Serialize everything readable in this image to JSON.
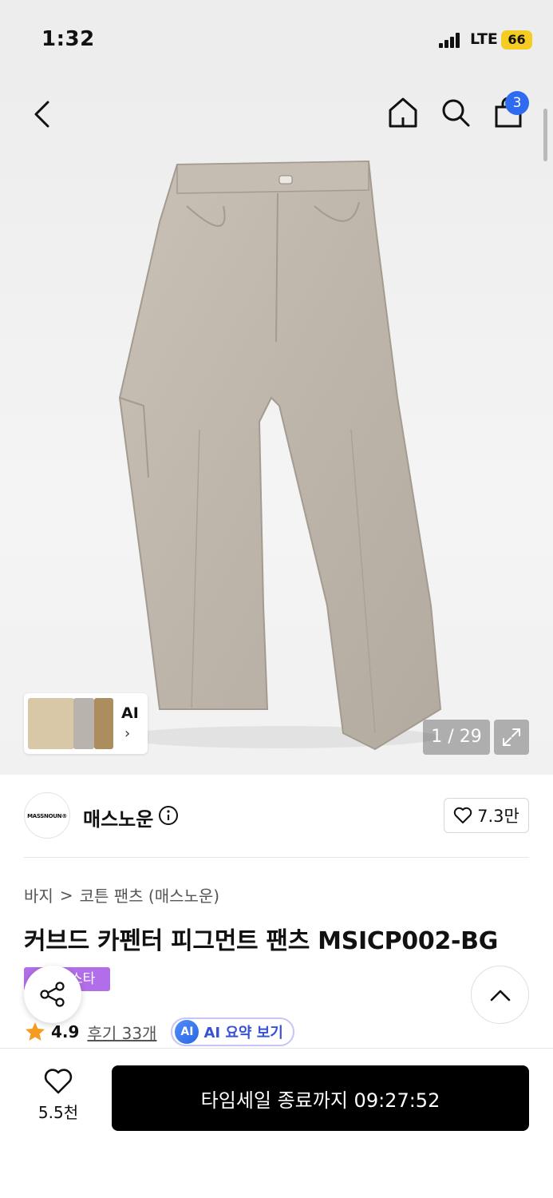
{
  "status": {
    "time": "1:32",
    "network": "LTE",
    "battery": "66"
  },
  "nav": {
    "cart_count": "3"
  },
  "gallery": {
    "counter": "1 / 29",
    "thumb_label": "AI",
    "thumb_chevron": "›"
  },
  "brand": {
    "name": "매스노운",
    "logo_text": "MASSNOUN®",
    "follow_count": "7.3만"
  },
  "breadcrumb": {
    "category": "바지",
    "separator": ">",
    "subcategory": "코튼 팬츠 (매스노운)"
  },
  "product": {
    "title": "커브드 카펜터 피그먼트 팬츠 MSICP002-BG",
    "tag": "스타"
  },
  "rating": {
    "score": "4.9",
    "reviews": "후기 33개",
    "ai_icon": "AI",
    "ai_summary": "AI 요약 보기"
  },
  "bottom": {
    "like_count": "5.5천",
    "cta": "타임세일 종료까지 09:27:52"
  },
  "colors": {
    "accent_blue": "#2f6bf0",
    "tag_purple": "#b16ee8",
    "star": "#f59b1f",
    "cta_bg": "#000000"
  }
}
